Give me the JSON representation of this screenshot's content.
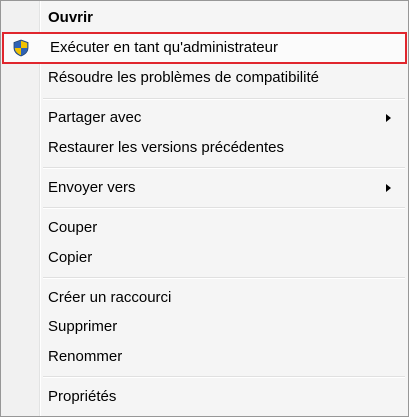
{
  "menu": {
    "open": "Ouvrir",
    "run_as_admin": "Exécuter en tant qu'administrateur",
    "compatibility": "Résoudre les problèmes de compatibilité",
    "share_with": "Partager avec",
    "restore_versions": "Restaurer les versions précédentes",
    "send_to": "Envoyer vers",
    "cut": "Couper",
    "copy": "Copier",
    "create_shortcut": "Créer un raccourci",
    "delete": "Supprimer",
    "rename": "Renommer",
    "properties": "Propriétés"
  },
  "icons": {
    "run_as_admin": "uac-shield-icon",
    "submenu": "submenu-arrow-icon"
  },
  "colors": {
    "highlight_border": "#e0262d",
    "menu_background": "#f5f5f5"
  }
}
